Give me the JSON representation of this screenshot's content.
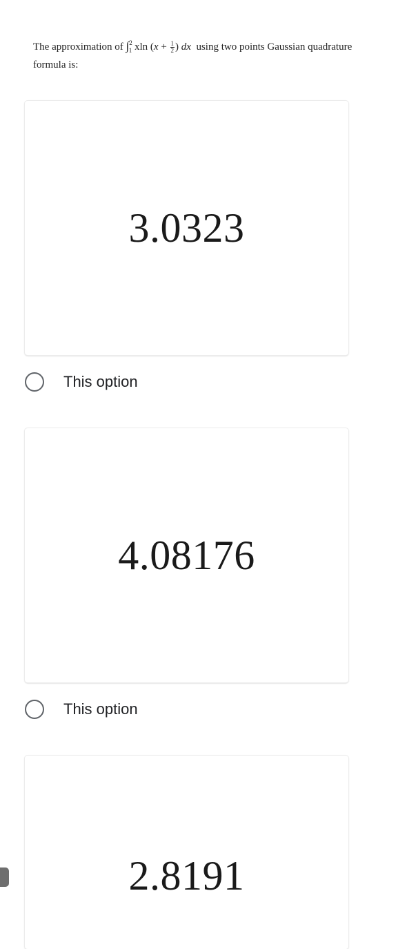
{
  "question": {
    "prefix": "The approximation of ",
    "integral_sign": "∫",
    "upper_limit": "2",
    "lower_limit": "1",
    "integrand_x": "x",
    "integrand_ln": "ln",
    "paren_open": " (",
    "var_x": "x",
    "plus": " + ",
    "frac_num": "1",
    "frac_den": "2",
    "paren_close": ")",
    "dx": " dx",
    "suffix": "  using two points Gaussian quadrature",
    "line2": "formula is:"
  },
  "options": [
    {
      "value": "3.0323",
      "label": "This option"
    },
    {
      "value": "4.08176",
      "label": "This option"
    },
    {
      "value": "2.8191"
    }
  ],
  "colors": {
    "radio_border": "#5f6368",
    "card_shadow": "#ececec",
    "text": "#202124",
    "edge_tab": "#6e6e6e"
  }
}
